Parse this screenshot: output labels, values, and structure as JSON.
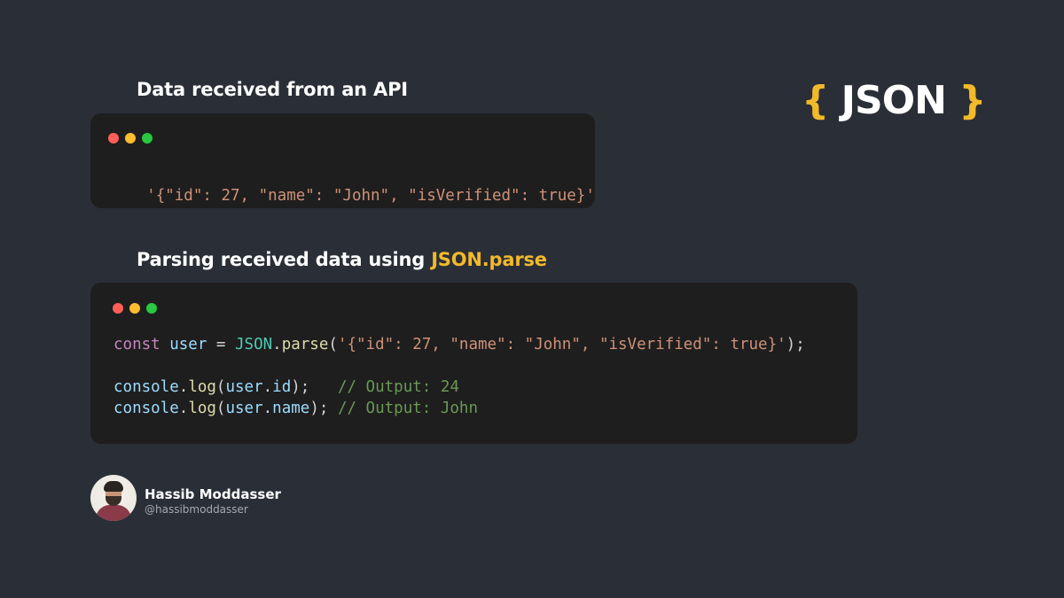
{
  "logo": {
    "open_brace": "{",
    "text": "JSON",
    "close_brace": "}"
  },
  "section1": {
    "heading": "Data received from an API",
    "code": "'{\"id\": 27, \"name\": \"John\", \"isVerified\": true}'"
  },
  "section2": {
    "heading_prefix": "Parsing received data using ",
    "heading_accent": "JSON.parse",
    "code": {
      "line1": {
        "kw": "const",
        "var": "user",
        "op": " = ",
        "cls": "JSON",
        "dot": ".",
        "fn": "parse",
        "open": "(",
        "str": "'{\"id\": 27, \"name\": \"John\", \"isVerified\": true}'",
        "close": ");"
      },
      "line2": {
        "obj": "console",
        "dot": ".",
        "fn": "log",
        "open": "(",
        "arg_obj": "user",
        "arg_dot": ".",
        "arg_prop": "id",
        "close": ");",
        "pad": "   ",
        "comment": "// Output: 24"
      },
      "line3": {
        "obj": "console",
        "dot": ".",
        "fn": "log",
        "open": "(",
        "arg_obj": "user",
        "arg_dot": ".",
        "arg_prop": "name",
        "close": ");",
        "pad": " ",
        "comment": "// Output: John"
      }
    }
  },
  "author": {
    "name": "Hassib Moddasser",
    "handle": "@hassibmoddasser"
  },
  "colors": {
    "background": "#2a2e37",
    "accent": "#f2b92b",
    "code_bg": "#1e1e1e",
    "dot_red": "#ff5f57",
    "dot_yellow": "#febc2e",
    "dot_green": "#28c840"
  },
  "icons": [
    "traffic-light-dots",
    "author-avatar"
  ]
}
